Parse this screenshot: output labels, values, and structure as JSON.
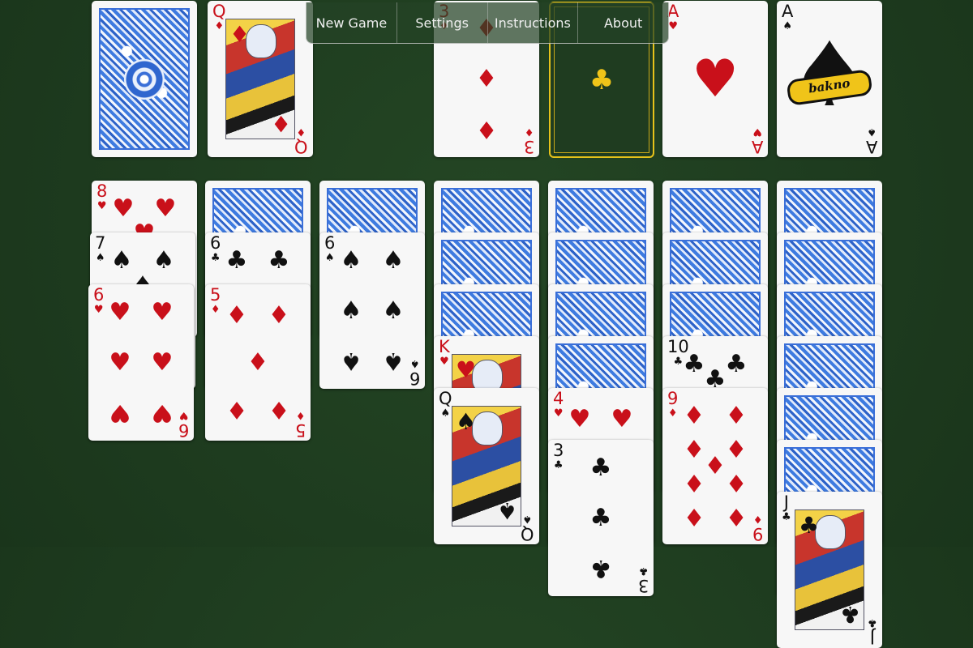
{
  "menu": {
    "items": [
      {
        "label": "New Game"
      },
      {
        "label": "Settings"
      },
      {
        "label": "Instructions"
      },
      {
        "label": "About"
      }
    ]
  },
  "colors": {
    "felt": "#1f3d20",
    "card_back_blue": "#3a6fd8",
    "red_suit": "#c9101a",
    "black_suit": "#111111",
    "highlight_gold": "#e6c21a"
  },
  "stock": {
    "face_down": true
  },
  "waste": {
    "rank": "Q",
    "suit": "♦",
    "color": "red"
  },
  "foundations": [
    {
      "rank": "3",
      "suit": "♦",
      "color": "red"
    },
    {
      "empty_suit": "♣",
      "selected": true
    },
    {
      "rank": "A",
      "suit": "♥",
      "color": "red"
    },
    {
      "rank": "A",
      "suit": "♠",
      "color": "black",
      "brand_text": "bakno"
    }
  ],
  "tableau": [
    {
      "face_down": 0,
      "face_up": [
        {
          "rank": "8",
          "suit": "♥",
          "color": "red"
        },
        {
          "rank": "7",
          "suit": "♠",
          "color": "black"
        },
        {
          "rank": "6",
          "suit": "♥",
          "color": "red"
        }
      ]
    },
    {
      "face_down": 1,
      "face_up": [
        {
          "rank": "6",
          "suit": "♣",
          "color": "black"
        },
        {
          "rank": "5",
          "suit": "♦",
          "color": "red"
        }
      ]
    },
    {
      "face_down": 1,
      "face_up": [
        {
          "rank": "6",
          "suit": "♠",
          "color": "black"
        }
      ]
    },
    {
      "face_down": 3,
      "face_up": [
        {
          "rank": "K",
          "suit": "♥",
          "color": "red"
        },
        {
          "rank": "Q",
          "suit": "♠",
          "color": "black"
        }
      ]
    },
    {
      "face_down": 4,
      "face_up": [
        {
          "rank": "4",
          "suit": "♥",
          "color": "red"
        },
        {
          "rank": "3",
          "suit": "♣",
          "color": "black"
        }
      ]
    },
    {
      "face_down": 3,
      "face_up": [
        {
          "rank": "10",
          "suit": "♣",
          "color": "black"
        },
        {
          "rank": "9",
          "suit": "♦",
          "color": "red"
        }
      ]
    },
    {
      "face_down": 6,
      "face_up": [
        {
          "rank": "J",
          "suit": "♣",
          "color": "black"
        }
      ]
    }
  ]
}
